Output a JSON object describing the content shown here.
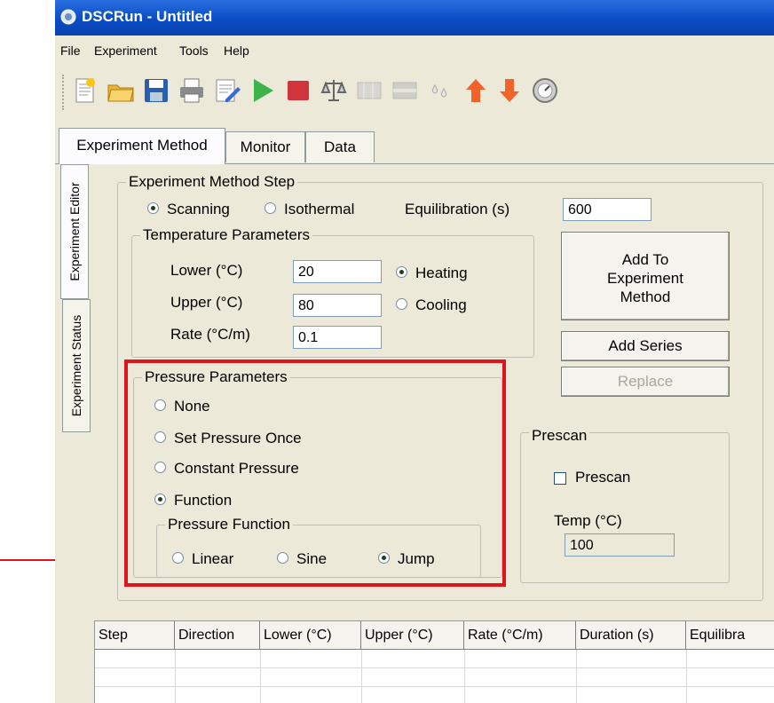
{
  "window": {
    "title": "DSCRun - Untitled"
  },
  "menu": [
    "File",
    "Experiment",
    "Tools",
    "Help"
  ],
  "toolbar": {
    "icons": [
      "new-file-icon",
      "open-folder-icon",
      "save-icon",
      "print-icon",
      "edit-icon",
      "play-icon",
      "stop-icon",
      "balance-icon",
      "disabled-icon",
      "disabled-icon",
      "droplets-icon",
      "up-arrow-icon",
      "down-arrow-icon",
      "gauge-icon"
    ]
  },
  "tabs": [
    "Experiment Method",
    "Monitor",
    "Data"
  ],
  "side_tabs": [
    "Experiment Editor",
    "Experiment Status"
  ],
  "method_step": {
    "title": "Experiment Method Step",
    "mode_options": [
      "Scanning",
      "Isothermal"
    ],
    "selected_mode": "Scanning",
    "equilibration_label": "Equilibration (s)",
    "equilibration_value": "600"
  },
  "temperature": {
    "title": "Temperature Parameters",
    "lower_label": "Lower (°C)",
    "lower_value": "20",
    "upper_label": "Upper (°C)",
    "upper_value": "80",
    "rate_label": "Rate (°C/m)",
    "rate_value": "0.1",
    "direction_options": [
      "Heating",
      "Cooling"
    ],
    "selected_direction": "Heating"
  },
  "buttons": {
    "add_to_method": [
      "Add To",
      "Experiment",
      "Method"
    ],
    "add_series": "Add Series",
    "replace": "Replace"
  },
  "pressure": {
    "title": "Pressure Parameters",
    "options": [
      "None",
      "Set Pressure Once",
      "Constant Pressure",
      "Function"
    ],
    "selected": "Function",
    "function_title": "Pressure Function",
    "function_options": [
      "Linear",
      "Sine",
      "Jump"
    ],
    "selected_function": "Jump"
  },
  "prescan": {
    "title": "Prescan",
    "checkbox_label": "Prescan",
    "checked": false,
    "temp_label": "Temp (°C)",
    "temp_value": "100"
  },
  "table": {
    "columns": [
      "Step",
      "Direction",
      "Lower (°C)",
      "Upper (°C)",
      "Rate (°C/m)",
      "Duration (s)",
      "Equilibra"
    ]
  },
  "colors": {
    "highlight": "#e0141c",
    "titlebar": "#0a4cc4"
  }
}
